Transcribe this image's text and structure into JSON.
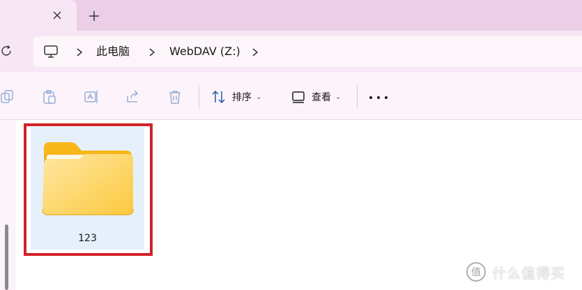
{
  "tabs": {
    "close_icon": "close-icon",
    "new_tab_icon": "plus-icon"
  },
  "address_bar": {
    "crumbs": [
      "此电脑",
      "WebDAV (Z:)"
    ],
    "root_icon": "computer-icon"
  },
  "toolbar": {
    "sort_label": "排序",
    "view_label": "查看",
    "icons": [
      "copy-icon",
      "paste-icon",
      "rename-icon",
      "share-icon",
      "delete-icon"
    ]
  },
  "files": [
    {
      "name": "123",
      "type": "folder"
    }
  ],
  "watermark": {
    "text": "什么值得买"
  },
  "colors": {
    "tabstrip": "#eccee7",
    "selection": "#e5f0fb",
    "highlight_border": "#d32027",
    "folder_yellow": "#fcd56a"
  }
}
